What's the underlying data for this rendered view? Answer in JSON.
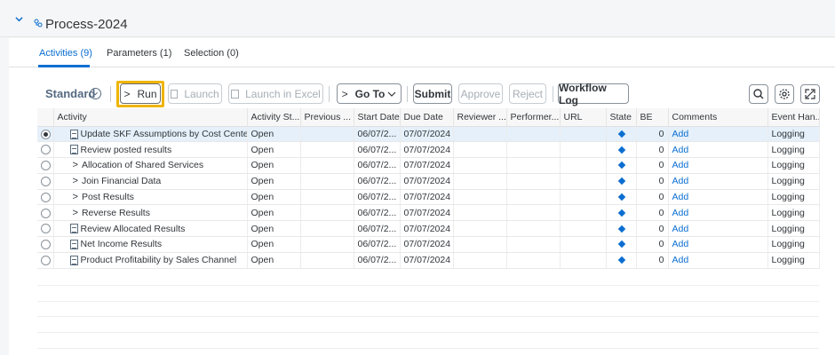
{
  "header": {
    "title": "Process-2024"
  },
  "tabs": [
    {
      "label": "Activities (9)",
      "active": true
    },
    {
      "label": "Parameters (1)",
      "active": false
    },
    {
      "label": "Selection (0)",
      "active": false
    }
  ],
  "toolbar": {
    "variant": "Standard",
    "run": "Run",
    "launch": "Launch",
    "launch_excel": "Launch in Excel",
    "goto": "Go To",
    "submit": "Submit",
    "approve": "Approve",
    "reject": "Reject",
    "workflow_log": "Workflow Log"
  },
  "table": {
    "columns": [
      "Activity",
      "Activity St...",
      "Previous ...",
      "Start Date",
      "Due Date",
      "Reviewer ...",
      "Performer...",
      "URL",
      "State",
      "BE",
      "Comments",
      "Event Han..."
    ],
    "rows": [
      {
        "activity": "Update SKF Assumptions by Cost Center",
        "status": "Open",
        "start": "06/07/2...",
        "due": "07/07/2024",
        "be": "0",
        "comment": "Add",
        "event": "Logging",
        "selected": true
      },
      {
        "activity": "Review posted results",
        "status": "Open",
        "start": "06/07/2...",
        "due": "07/07/2024",
        "be": "0",
        "comment": "Add",
        "event": "Logging"
      },
      {
        "activity": "Allocation of Shared Services",
        "status": "Open",
        "start": "06/07/2...",
        "due": "07/07/2024",
        "be": "0",
        "comment": "Add",
        "event": "Logging"
      },
      {
        "activity": "Join Financial Data",
        "status": "Open",
        "start": "06/07/2...",
        "due": "07/07/2024",
        "be": "0",
        "comment": "Add",
        "event": "Logging"
      },
      {
        "activity": "Post Results",
        "status": "Open",
        "start": "06/07/2...",
        "due": "07/07/2024",
        "be": "0",
        "comment": "Add",
        "event": "Logging"
      },
      {
        "activity": "Reverse Results",
        "status": "Open",
        "start": "06/07/2...",
        "due": "07/07/2024",
        "be": "0",
        "comment": "Add",
        "event": "Logging"
      },
      {
        "activity": "Review Allocated Results",
        "status": "Open",
        "start": "06/07/2...",
        "due": "07/07/2024",
        "be": "0",
        "comment": "Add",
        "event": "Logging"
      },
      {
        "activity": "Net Income Results",
        "status": "Open",
        "start": "06/07/2...",
        "due": "07/07/2024",
        "be": "0",
        "comment": "Add",
        "event": "Logging"
      },
      {
        "activity": "Product Profitability by Sales Channel",
        "status": "Open",
        "start": "06/07/2...",
        "due": "07/07/2024",
        "be": "0",
        "comment": "Add",
        "event": "Logging"
      }
    ]
  }
}
